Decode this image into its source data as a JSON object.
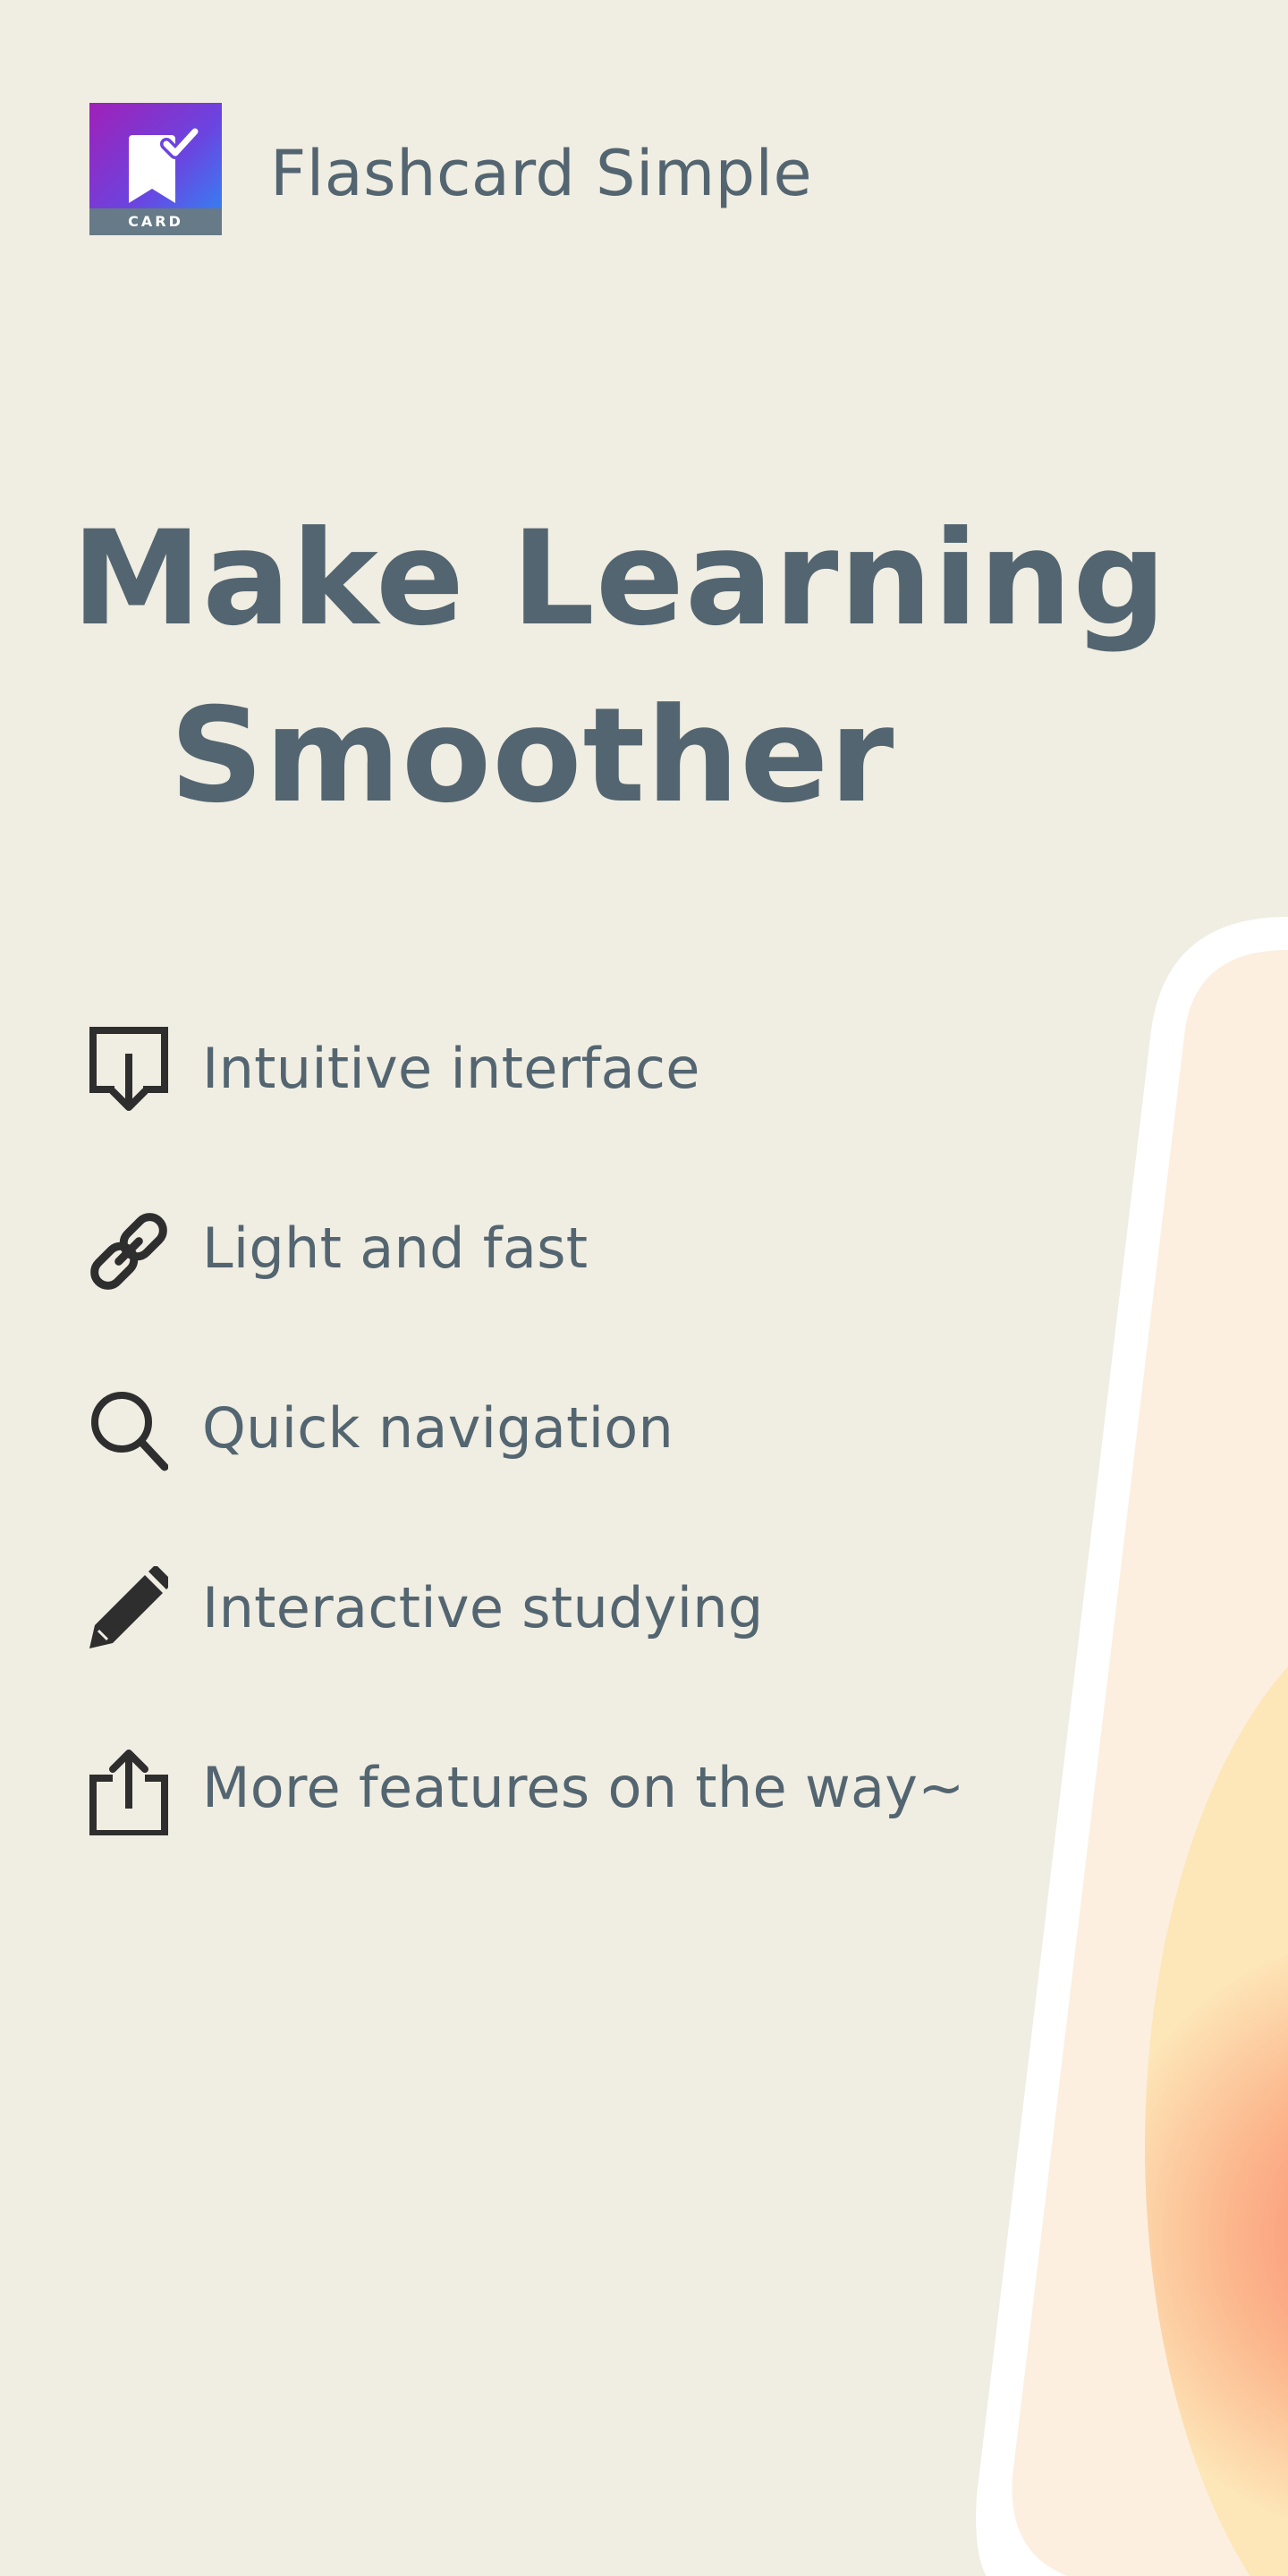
{
  "header": {
    "app_name": "Flashcard Simple",
    "icon_badge": "CARD",
    "icon_name": "bookmark-check-icon"
  },
  "hero": {
    "line1": "Make Learning",
    "line2": "Smoother"
  },
  "features": [
    {
      "icon": "download-box-icon",
      "label": "Intuitive interface"
    },
    {
      "icon": "link-icon",
      "label": "Light and fast"
    },
    {
      "icon": "search-icon",
      "label": "Quick navigation"
    },
    {
      "icon": "pencil-icon",
      "label": "Interactive studying"
    },
    {
      "icon": "share-icon",
      "label": "More features on the way~"
    }
  ],
  "colors": {
    "background": "#f0ede2",
    "text": "#536570",
    "icon": "#2e2e2e",
    "accent_gradient_start": "#a020b8",
    "accent_gradient_end": "#2a8cf6",
    "phone_frame": "#ffffff",
    "phone_screen": "#fcefe0"
  }
}
